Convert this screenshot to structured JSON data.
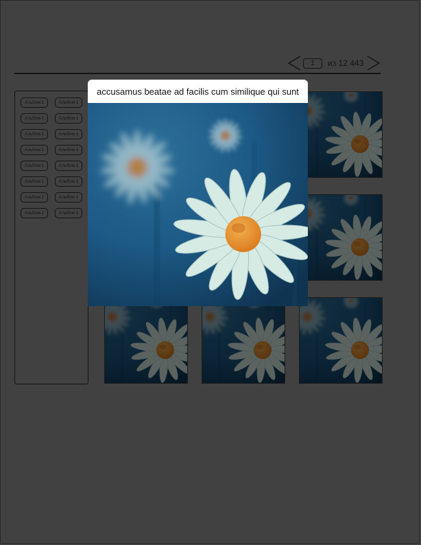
{
  "pagination": {
    "current_page": "1",
    "total_label": "из 12 443"
  },
  "sidebar": {
    "albums": [
      "Альбом 1",
      "Альбом 1",
      "Альбом 1",
      "Альбом 1",
      "Альбом 1",
      "Альбом 1",
      "Альбом 1",
      "Альбом 1",
      "Альбом 1",
      "Альбом 1",
      "Альбом 1",
      "Альбом 1",
      "Альбом 1",
      "Альбом 1",
      "Альбом 1",
      "Альбом 1"
    ]
  },
  "popup": {
    "caption": "accusamus beatae ad facilis cum similique qui sunt",
    "image": "daisy-photo"
  },
  "gallery": {
    "thumbnail_count": 9,
    "thumbnail_image": "daisy-photo"
  },
  "colors": {
    "page_background": "#414141",
    "overlay_text": "#151515",
    "photo_blue": "#1d5a86",
    "petal": "#d6ebe4",
    "flower_center": "#ec8f2c"
  }
}
